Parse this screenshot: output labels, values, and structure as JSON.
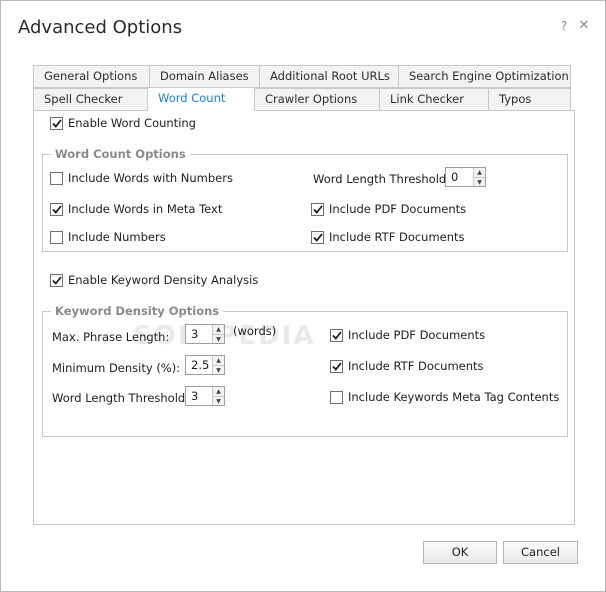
{
  "window": {
    "title": "Advanced Options",
    "help_label": "?",
    "close_label": "✕"
  },
  "tabs_row1": [
    {
      "label": "General Options",
      "active": false
    },
    {
      "label": "Domain Aliases",
      "active": false
    },
    {
      "label": "Additional Root URLs",
      "active": false
    },
    {
      "label": "Search Engine Optimization",
      "active": false
    }
  ],
  "tabs_row2": [
    {
      "label": "Spell Checker",
      "active": false
    },
    {
      "label": "Word Count",
      "active": true
    },
    {
      "label": "Crawler Options",
      "active": false
    },
    {
      "label": "Link Checker",
      "active": false
    },
    {
      "label": "Typos",
      "active": false
    }
  ],
  "word_counting": {
    "enable_label": "Enable Word Counting",
    "enable_checked": true
  },
  "word_count_options": {
    "legend": "Word Count Options",
    "include_words_with_numbers": {
      "label": "Include Words with Numbers",
      "checked": false
    },
    "include_words_meta_text": {
      "label": "Include Words in Meta Text",
      "checked": true
    },
    "include_numbers": {
      "label": "Include Numbers",
      "checked": false
    },
    "word_length_threshold_label": "Word Length Threshold:",
    "word_length_threshold_value": "0",
    "include_pdf": {
      "label": "Include PDF Documents",
      "checked": true
    },
    "include_rtf": {
      "label": "Include RTF Documents",
      "checked": true
    }
  },
  "keyword_density": {
    "enable_label": "Enable Keyword Density Analysis",
    "enable_checked": true
  },
  "keyword_density_options": {
    "legend": "Keyword Density Options",
    "max_phrase_label": "Max. Phrase Length:",
    "max_phrase_value": "3",
    "max_phrase_unit": "(words)",
    "min_density_label": "Minimum Density (%):",
    "min_density_value": "2.5",
    "word_length_label": "Word Length Threshold:",
    "word_length_value": "3",
    "include_pdf": {
      "label": "Include PDF Documents",
      "checked": true
    },
    "include_rtf": {
      "label": "Include RTF Documents",
      "checked": true
    },
    "include_keywords_meta": {
      "label": "Include Keywords Meta Tag Contents",
      "checked": false
    }
  },
  "watermark": "SOFTPEDIA",
  "buttons": {
    "ok_label": "OK",
    "cancel_label": "Cancel"
  },
  "colors": {
    "active_tab_text": "#1e7fd0",
    "border": "#c8c8c8",
    "legend_text": "#8a8a8a"
  }
}
